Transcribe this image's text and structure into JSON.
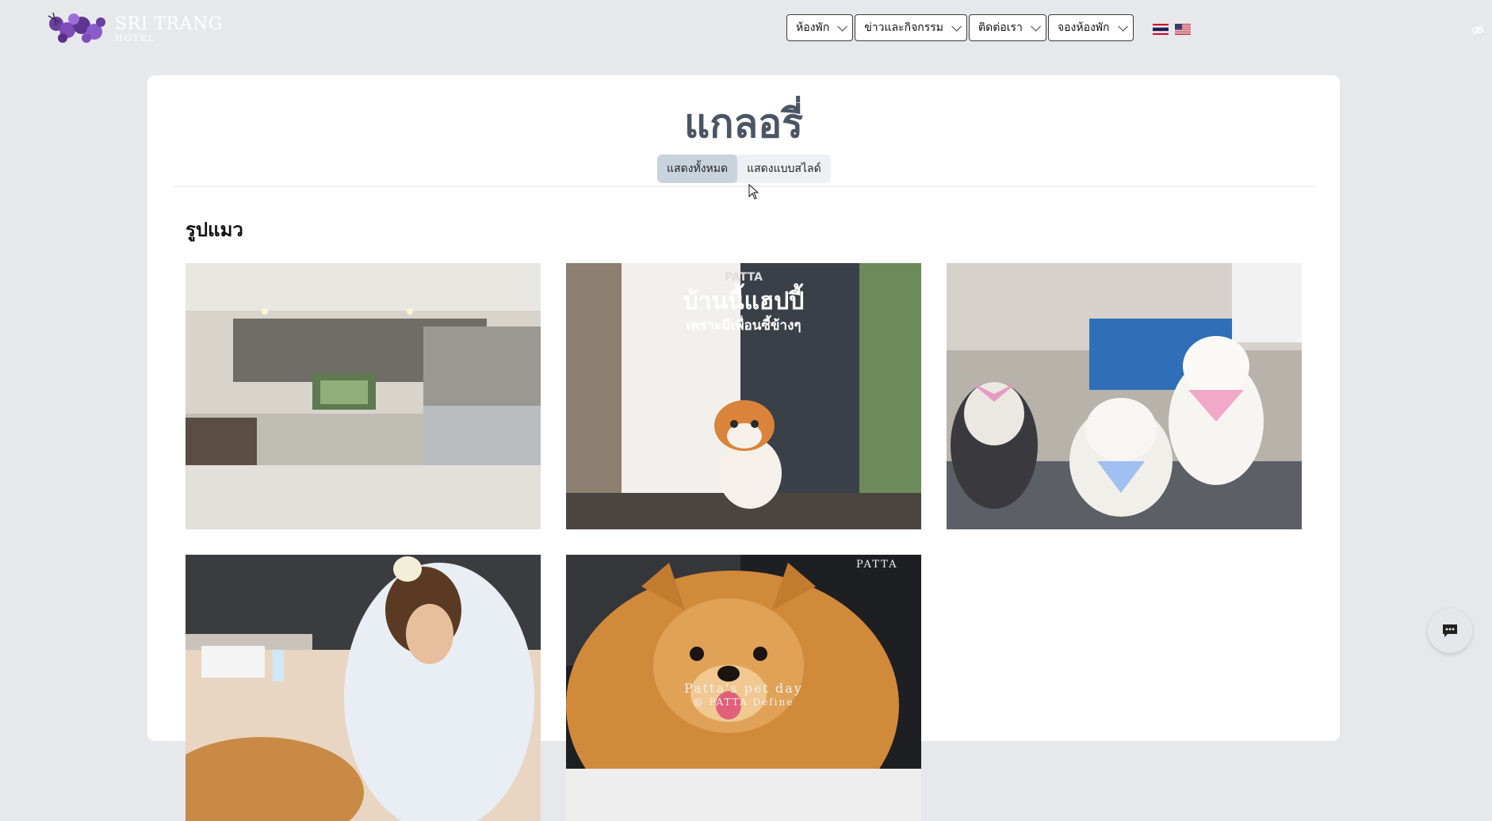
{
  "header": {
    "logo": {
      "name": "SRI TRANG",
      "sub": "HOTEL"
    },
    "nav": [
      {
        "label": "ห้องพัก"
      },
      {
        "label": "ข่าวและกิจกรรม"
      },
      {
        "label": "ติดต่อเรา"
      },
      {
        "label": "จองห้องพัก"
      }
    ],
    "languages": [
      {
        "icon": "thai-flag-icon",
        "code": "TH"
      },
      {
        "icon": "us-flag-icon",
        "code": "EN"
      }
    ]
  },
  "gallery": {
    "title": "แกลอรี่",
    "tabs": [
      {
        "label": "แสดงทั้งหมด",
        "active": true
      },
      {
        "label": "แสดงแบบสไลด์",
        "active": false
      }
    ],
    "section_title": "รูปแมว",
    "images": [
      {
        "subject": "modern kitchen interior",
        "overlay": []
      },
      {
        "subject": "scottish fold cat beside white curtain",
        "overlay": [
          "PATTA",
          "บ้านนี้แฮปปี้",
          "เพราะมีเพื่อนซี้ข้างๆ"
        ]
      },
      {
        "subject": "three husky and samoyed dogs in lobby",
        "overlay": []
      },
      {
        "subject": "vet examining a dog",
        "overlay": []
      },
      {
        "subject": "pomeranian dog smiling",
        "overlay": [
          "PATTA",
          "Patta's pet day",
          "@ PATTA Define"
        ]
      }
    ]
  },
  "colors": {
    "background": "#e7e8ec",
    "card": "#ffffff",
    "title": "#4b5563",
    "active_tab": "#c9d3dd"
  },
  "chat": {
    "icon": "chat-bubble-icon"
  }
}
